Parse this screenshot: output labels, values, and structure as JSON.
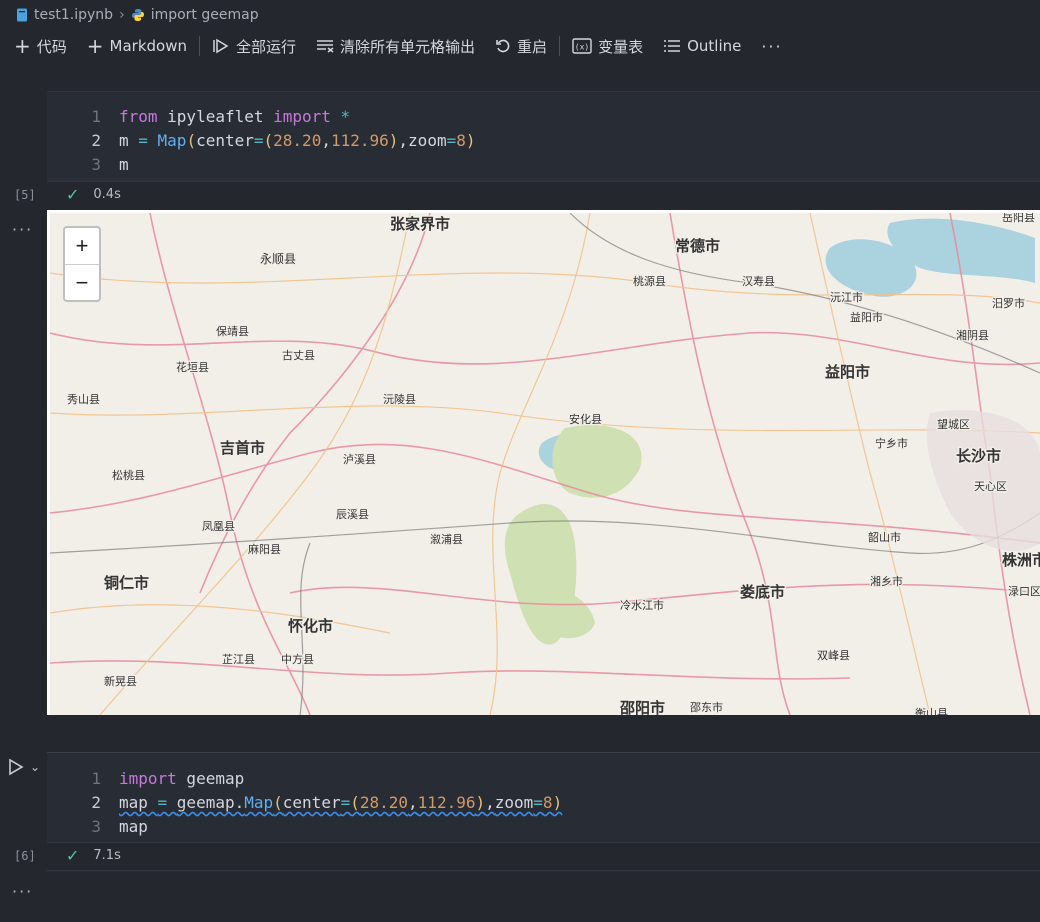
{
  "breadcrumb": {
    "file": "test1.ipynb",
    "section": "import geemap"
  },
  "toolbar": {
    "code": "代码",
    "markdown": "Markdown",
    "run_all": "全部运行",
    "clear_outputs": "清除所有单元格输出",
    "restart": "重启",
    "variables": "变量表",
    "outline": "Outline",
    "more": "···"
  },
  "cell1": {
    "lines": [
      {
        "n": "1",
        "t": [
          [
            "kw",
            "from"
          ],
          [
            "",
            " ipyleaflet "
          ],
          [
            "kw",
            "import"
          ],
          [
            "op",
            " *"
          ]
        ]
      },
      {
        "n": "2",
        "t": [
          [
            "",
            "m "
          ],
          [
            "op",
            "= "
          ],
          [
            "fn",
            "Map"
          ],
          [
            "punc",
            "("
          ],
          [
            "",
            "center"
          ],
          [
            "op",
            "="
          ],
          [
            "punc",
            "("
          ],
          [
            "num",
            "28.20"
          ],
          [
            "",
            ","
          ],
          [
            "num",
            "112.96"
          ],
          [
            "punc",
            ")"
          ],
          [
            "",
            ","
          ],
          [
            "",
            "zoom"
          ],
          [
            "op",
            "="
          ],
          [
            "num",
            "8"
          ],
          [
            "punc",
            ")"
          ]
        ]
      },
      {
        "n": "3",
        "t": [
          [
            "",
            "m"
          ]
        ]
      }
    ],
    "exec_count": "[5]",
    "duration": "0.4s"
  },
  "output_more": "···",
  "map": {
    "zoom_in": "+",
    "zoom_out": "−",
    "labels": [
      "张家界市",
      "永顺县",
      "常德市",
      "桃源县",
      "汉寿县",
      "沅江市",
      "益阳市",
      "汨罗市",
      "湘阴县",
      "岳阳县",
      "保靖县",
      "古丈县",
      "花垣县",
      "沅陵县",
      "益阳市",
      "秀山县",
      "安化县",
      "望城区",
      "宁乡市",
      "长沙市",
      "吉首市",
      "泸溪县",
      "天心区",
      "松桃县",
      "辰溪县",
      "溆浦县",
      "凤凰县",
      "麻阳县",
      "韶山市",
      "株洲市",
      "湘乡市",
      "铜仁市",
      "冷水江市",
      "娄底市",
      "渌口区",
      "怀化市",
      "芷江县",
      "中方县",
      "双峰县",
      "新晃县",
      "邵阳市",
      "邵东市",
      "衡山县"
    ]
  },
  "cell2": {
    "lines": [
      {
        "n": "1",
        "t": [
          [
            "kw",
            "import"
          ],
          [
            "",
            " geemap"
          ]
        ]
      },
      {
        "n": "2",
        "t": [
          [
            "",
            "map "
          ],
          [
            "op",
            "= "
          ],
          [
            "",
            "geemap."
          ],
          [
            "fn",
            "Map"
          ],
          [
            "punc",
            "("
          ],
          [
            "",
            "center"
          ],
          [
            "op",
            "="
          ],
          [
            "punc",
            "("
          ],
          [
            "num",
            "28.20"
          ],
          [
            "",
            ","
          ],
          [
            "num",
            "112.96"
          ],
          [
            "punc",
            ")"
          ],
          [
            "",
            ","
          ],
          [
            "",
            "zoom"
          ],
          [
            "op",
            "="
          ],
          [
            "num",
            "8"
          ],
          [
            "punc",
            ")"
          ]
        ]
      },
      {
        "n": "3",
        "t": [
          [
            "",
            "map"
          ]
        ]
      }
    ],
    "exec_count": "[6]",
    "duration": "7.1s"
  },
  "bottom_more": "···"
}
